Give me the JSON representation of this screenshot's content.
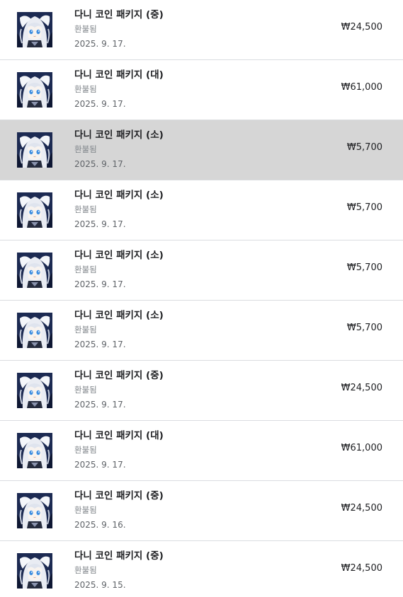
{
  "purchases": [
    {
      "title": "다니 코인 패키지 (중)",
      "status": "환불됨",
      "date": "2025. 9. 17.",
      "price": "₩24,500",
      "selected": false
    },
    {
      "title": "다니 코인 패키지 (대)",
      "status": "환불됨",
      "date": "2025. 9. 17.",
      "price": "₩61,000",
      "selected": false
    },
    {
      "title": "다니 코인 패키지 (소)",
      "status": "환불됨",
      "date": "2025. 9. 17.",
      "price": "₩5,700",
      "selected": true
    },
    {
      "title": "다니 코인 패키지 (소)",
      "status": "환불됨",
      "date": "2025. 9. 17.",
      "price": "₩5,700",
      "selected": false
    },
    {
      "title": "다니 코인 패키지 (소)",
      "status": "환불됨",
      "date": "2025. 9. 17.",
      "price": "₩5,700",
      "selected": false
    },
    {
      "title": "다니 코인 패키지 (소)",
      "status": "환불됨",
      "date": "2025. 9. 17.",
      "price": "₩5,700",
      "selected": false
    },
    {
      "title": "다니 코인 패키지 (중)",
      "status": "환불됨",
      "date": "2025. 9. 17.",
      "price": "₩24,500",
      "selected": false
    },
    {
      "title": "다니 코인 패키지 (대)",
      "status": "환불됨",
      "date": "2025. 9. 17.",
      "price": "₩61,000",
      "selected": false
    },
    {
      "title": "다니 코인 패키지 (중)",
      "status": "환불됨",
      "date": "2025. 9. 16.",
      "price": "₩24,500",
      "selected": false
    },
    {
      "title": "다니 코인 패키지 (중)",
      "status": "환불됨",
      "date": "2025. 9. 15.",
      "price": "₩24,500",
      "selected": false
    }
  ],
  "icons": {
    "thumbnail": "anime-character-avatar-icon"
  },
  "colors": {
    "selected_row": "#d6d6d6",
    "divider": "#dadce0"
  }
}
